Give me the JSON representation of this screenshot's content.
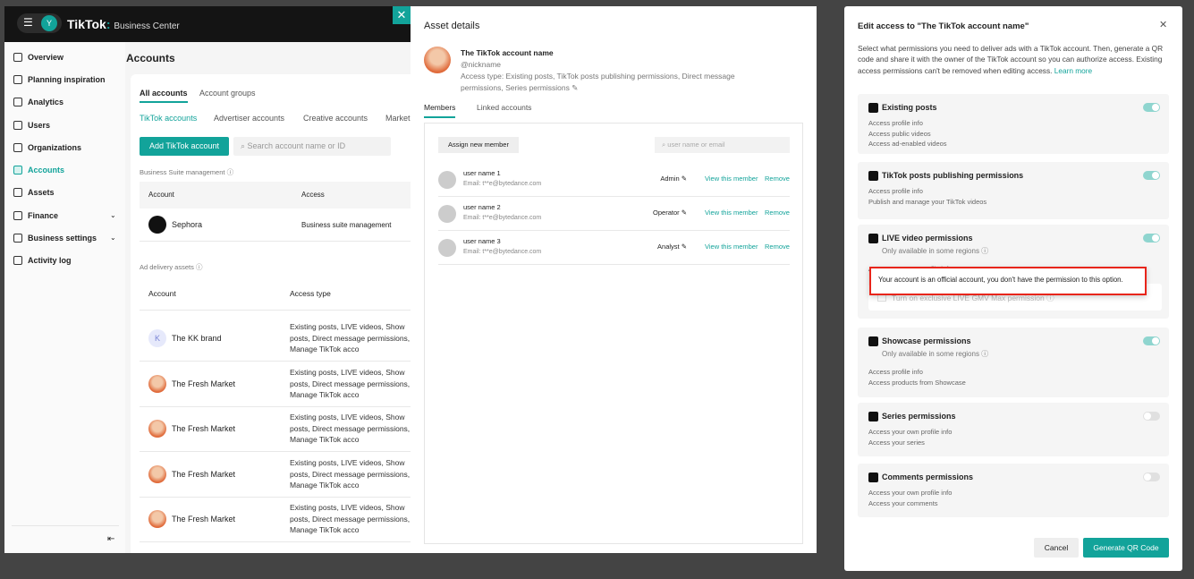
{
  "header": {
    "avatar": "Y",
    "brand": "TikTok",
    "product": "Business Center"
  },
  "sidebar": {
    "items": [
      {
        "label": "Overview"
      },
      {
        "label": "Planning inspiration"
      },
      {
        "label": "Analytics"
      },
      {
        "label": "Users"
      },
      {
        "label": "Organizations"
      },
      {
        "label": "Accounts"
      },
      {
        "label": "Assets"
      },
      {
        "label": "Finance"
      },
      {
        "label": "Business settings"
      },
      {
        "label": "Activity log"
      }
    ]
  },
  "main": {
    "title": "Accounts",
    "tabs": [
      "All accounts",
      "Account groups"
    ],
    "subtabs": [
      "TikTok accounts",
      "Advertiser accounts",
      "Creative accounts",
      "Market"
    ],
    "add_button": "Add TikTok account",
    "search_placeholder": "Search account name or ID",
    "bsm": {
      "label": "Business Suite management",
      "cols": [
        "Account",
        "Access"
      ],
      "row": {
        "name": "Sephora",
        "access": "Business suite management"
      }
    },
    "ada": {
      "label": "Ad delivery assets",
      "cols": [
        "Account",
        "Access type"
      ],
      "rows": [
        {
          "name": "The KK brand",
          "initial": "K",
          "access": "Existing posts, LIVE videos, Show posts, Direct message permissions, Manage TikTok acco"
        },
        {
          "name": "The Fresh Market",
          "access": "Existing posts, LIVE videos, Show posts, Direct message permissions, Manage TikTok acco"
        },
        {
          "name": "The Fresh Market",
          "access": "Existing posts, LIVE videos, Show posts, Direct message permissions, Manage TikTok acco"
        },
        {
          "name": "The Fresh Market",
          "access": "Existing posts, LIVE videos, Show posts, Direct message permissions, Manage TikTok acco"
        },
        {
          "name": "The Fresh Market",
          "access": "Existing posts, LIVE videos, Show posts, Direct message permissions, Manage TikTok acco"
        }
      ]
    }
  },
  "panel": {
    "title": "Asset details",
    "account_name": "The TikTok account name",
    "nickname": "@nickname",
    "access_type": "Access type: Existing posts, TikTok posts publishing permissions, Direct message permissions, Series permissions",
    "tabs": [
      "Members",
      "Linked accounts"
    ],
    "assign_button": "Assign new member",
    "member_search_placeholder": "user name or email",
    "members": [
      {
        "name": "user name 1",
        "email": "Email: t**e@bytedance.com",
        "role": "Admin"
      },
      {
        "name": "user name 2",
        "email": "Email: t**e@bytedance.com",
        "role": "Operator"
      },
      {
        "name": "user name 3",
        "email": "Email: t**e@bytedance.com",
        "role": "Analyst"
      }
    ],
    "view_label": "View this member",
    "remove_label": "Remove"
  },
  "modal": {
    "title": "Edit access to \"The TikTok account name\"",
    "description": "Select what permissions you need to deliver ads with a TikTok account. Then, generate a QR code and share it with the owner of the TikTok account so you can authorize access. Existing access permissions can't be removed when editing access.",
    "learn_more": "Learn more",
    "regions_note": "Only available in some regions",
    "sections": [
      {
        "title": "Existing posts",
        "on": true,
        "bullets": [
          "Access profile info",
          "Access public videos",
          "Access ad-enabled videos"
        ]
      },
      {
        "title": "TikTok posts publishing permissions",
        "on": true,
        "bullets": [
          "Access profile info",
          "Publish and manage your TikTok videos"
        ]
      },
      {
        "title": "LIVE video permissions",
        "on": true,
        "bullets": [
          "Access your own profile info"
        ]
      },
      {
        "title": "Showcase permissions",
        "on": true,
        "bullets": [
          "Access profile info",
          "Access products from Showcase"
        ]
      },
      {
        "title": "Series permissions",
        "on": false,
        "bullets": [
          "Access your own profile info",
          "Access your series"
        ]
      },
      {
        "title": "Comments permissions",
        "on": false,
        "bullets": [
          "Access your own profile info",
          "Access your comments"
        ]
      }
    ],
    "gmv_checkbox": "Turn on exclusive LIVE GMV Max permission",
    "tooltip": "Your account is an official account, you don't have the permission to this option.",
    "cancel": "Cancel",
    "generate": "Generate QR Code"
  },
  "colors": {
    "accent": "#12a39a",
    "highlight": "#e8251b"
  }
}
